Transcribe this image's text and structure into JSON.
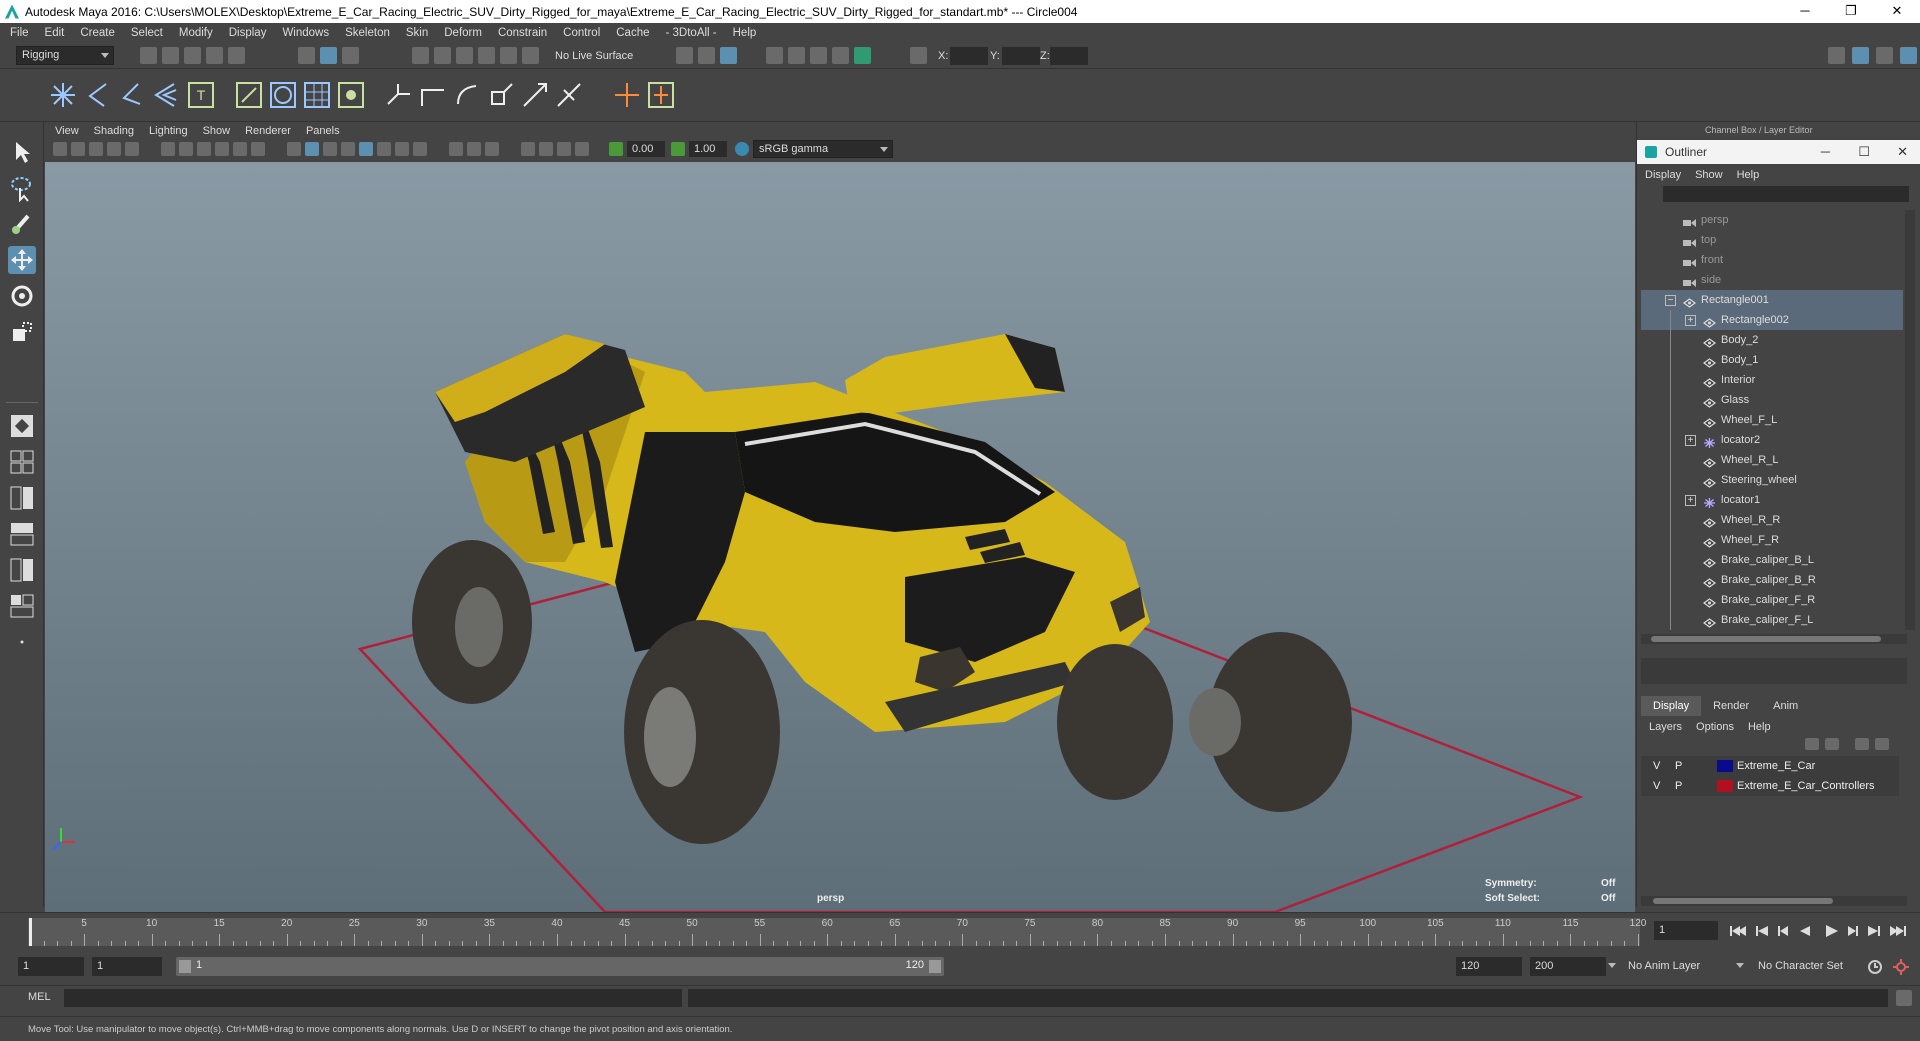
{
  "window": {
    "title": "Autodesk Maya 2016: C:\\Users\\MOLEX\\Desktop\\Extreme_E_Car_Racing_Electric_SUV_Dirty_Rigged_for_maya\\Extreme_E_Car_Racing_Electric_SUV_Dirty_Rigged_for_standart.mb*  ---  Circle004",
    "minimize": "─",
    "restore": "❐",
    "close": "✕"
  },
  "menubar": [
    "File",
    "Edit",
    "Create",
    "Select",
    "Modify",
    "Display",
    "Windows",
    "Skeleton",
    "Skin",
    "Deform",
    "Constrain",
    "Control",
    "Cache",
    "- 3DtoAll -",
    "Help"
  ],
  "statusline": {
    "menuset": "Rigging",
    "live_surface": "No Live Surface",
    "x_label": "X:",
    "y_label": "Y:",
    "z_label": "Z:"
  },
  "viewport": {
    "menu": [
      "View",
      "Shading",
      "Lighting",
      "Show",
      "Renderer",
      "Panels"
    ],
    "exposure": "0.00",
    "gamma": "1.00",
    "color_space": "sRGB gamma",
    "camera_label": "persp",
    "symmetry_label": "Symmetry:",
    "symmetry_value": "Off",
    "soft_select_label": "Soft Select:",
    "soft_select_value": "Off"
  },
  "right_panel": {
    "header": "Channel Box / Layer Editor",
    "outliner_title": "Outliner",
    "outliner_menu": [
      "Display",
      "Show",
      "Help"
    ],
    "outliner_items": [
      {
        "label": "persp",
        "type": "camera"
      },
      {
        "label": "top",
        "type": "camera"
      },
      {
        "label": "front",
        "type": "camera"
      },
      {
        "label": "side",
        "type": "camera"
      },
      {
        "label": "Rectangle001",
        "type": "curve",
        "selected": true,
        "expander": "−"
      },
      {
        "label": "Rectangle002",
        "type": "curve",
        "selected": true,
        "expander": "+"
      },
      {
        "label": "Body_2",
        "type": "mesh"
      },
      {
        "label": "Body_1",
        "type": "mesh"
      },
      {
        "label": "Interior",
        "type": "mesh"
      },
      {
        "label": "Glass",
        "type": "mesh"
      },
      {
        "label": "Wheel_F_L",
        "type": "mesh"
      },
      {
        "label": "locator2",
        "type": "locator",
        "expander": "+"
      },
      {
        "label": "Wheel_R_L",
        "type": "mesh"
      },
      {
        "label": "Steering_wheel",
        "type": "mesh"
      },
      {
        "label": "locator1",
        "type": "locator",
        "expander": "+"
      },
      {
        "label": "Wheel_R_R",
        "type": "mesh"
      },
      {
        "label": "Wheel_F_R",
        "type": "mesh"
      },
      {
        "label": "Brake_caliper_B_L",
        "type": "mesh"
      },
      {
        "label": "Brake_caliper_B_R",
        "type": "mesh"
      },
      {
        "label": "Brake_caliper_F_R",
        "type": "mesh"
      },
      {
        "label": "Brake_caliper_F_L",
        "type": "mesh"
      }
    ],
    "layer_tabs": [
      "Display",
      "Render",
      "Anim"
    ],
    "layer_menu": [
      "Layers",
      "Options",
      "Help"
    ],
    "layers": [
      {
        "v": "V",
        "p": "P",
        "name": "Extreme_E_Car",
        "color": "#0a0a8c"
      },
      {
        "v": "V",
        "p": "P",
        "name": "Extreme_E_Car_Controllers",
        "color": "#b01020"
      }
    ]
  },
  "timeline": {
    "ticks": [
      5,
      10,
      15,
      20,
      25,
      30,
      35,
      40,
      45,
      50,
      55,
      60,
      65,
      70,
      75,
      80,
      85,
      90,
      95,
      100,
      105,
      110,
      115,
      120
    ],
    "current_frame": "1",
    "start_frame": "1",
    "range_start": "1",
    "range_field": "1",
    "range_end_inner": "120",
    "range_end": "120",
    "anim_end": "200",
    "anim_layer": "No Anim Layer",
    "character_set": "No Character Set"
  },
  "command_line": {
    "label": "MEL"
  },
  "help_line": "Move Tool: Use manipulator to move object(s). Ctrl+MMB+drag to move components along normals. Use D or INSERT to change the pivot position and axis orientation.",
  "colors": {
    "car_yellow": "#d6b81a",
    "grid_red": "#b0203a",
    "selection_blue": "#5a6a7a",
    "accent_teal": "#1aa4a0"
  }
}
